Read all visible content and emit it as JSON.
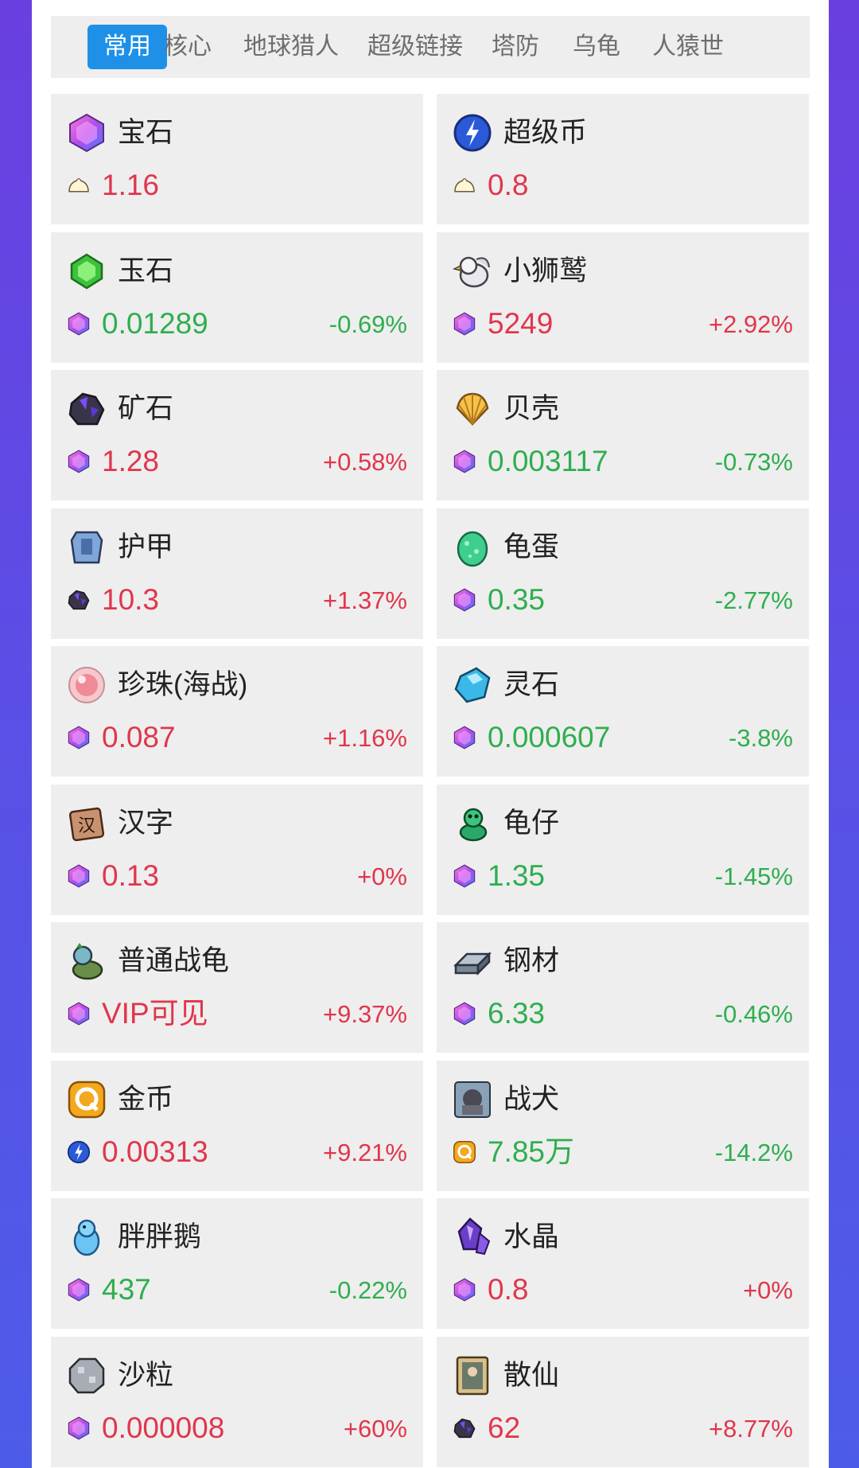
{
  "tabs": [
    {
      "label": "常用",
      "active": true
    },
    {
      "label": "核心",
      "active": false
    },
    {
      "label": "地球猎人",
      "active": false
    },
    {
      "label": "超级链接",
      "active": false
    },
    {
      "label": "塔防",
      "active": false
    },
    {
      "label": "乌龟",
      "active": false
    },
    {
      "label": "人猿世",
      "active": false
    }
  ],
  "colors": {
    "up": "#e0364d",
    "down": "#2fae4f",
    "tab_active": "#1e90e8"
  },
  "items": [
    {
      "name": "宝石",
      "icon": "gem-icon",
      "currency_icon": "bun-icon",
      "price": "1.16",
      "change": "",
      "trend": "up"
    },
    {
      "name": "超级币",
      "icon": "super-coin-icon",
      "currency_icon": "bun-icon",
      "price": "0.8",
      "change": "",
      "trend": "up"
    },
    {
      "name": "玉石",
      "icon": "jade-icon",
      "currency_icon": "gem-icon",
      "price": "0.01289",
      "change": "-0.69%",
      "trend": "down"
    },
    {
      "name": "小狮鹫",
      "icon": "griffin-icon",
      "currency_icon": "gem-icon",
      "price": "5249",
      "change": "+2.92%",
      "trend": "up"
    },
    {
      "name": "矿石",
      "icon": "ore-icon",
      "currency_icon": "gem-icon",
      "price": "1.28",
      "change": "+0.58%",
      "trend": "up"
    },
    {
      "name": "贝壳",
      "icon": "shell-icon",
      "currency_icon": "gem-icon",
      "price": "0.003117",
      "change": "-0.73%",
      "trend": "down"
    },
    {
      "name": "护甲",
      "icon": "armor-icon",
      "currency_icon": "ore-icon",
      "price": "10.3",
      "change": "+1.37%",
      "trend": "up"
    },
    {
      "name": "龟蛋",
      "icon": "turtle-egg-icon",
      "currency_icon": "gem-icon",
      "price": "0.35",
      "change": "-2.77%",
      "trend": "down"
    },
    {
      "name": "珍珠(海战)",
      "icon": "pearl-icon",
      "currency_icon": "gem-icon",
      "price": "0.087",
      "change": "+1.16%",
      "trend": "up"
    },
    {
      "name": "灵石",
      "icon": "spirit-stone-icon",
      "currency_icon": "gem-icon",
      "price": "0.000607",
      "change": "-3.8%",
      "trend": "down"
    },
    {
      "name": "汉字",
      "icon": "hanzi-tile-icon",
      "currency_icon": "gem-icon",
      "price": "0.13",
      "change": "+0%",
      "trend": "up"
    },
    {
      "name": "龟仔",
      "icon": "baby-turtle-icon",
      "currency_icon": "gem-icon",
      "price": "1.35",
      "change": "-1.45%",
      "trend": "down"
    },
    {
      "name": "普通战龟",
      "icon": "war-turtle-icon",
      "currency_icon": "gem-icon",
      "price": "VIP可见",
      "change": "+9.37%",
      "trend": "up"
    },
    {
      "name": "钢材",
      "icon": "steel-icon",
      "currency_icon": "gem-icon",
      "price": "6.33",
      "change": "-0.46%",
      "trend": "down"
    },
    {
      "name": "金币",
      "icon": "gold-coin-icon",
      "currency_icon": "super-coin-icon",
      "price": "0.00313",
      "change": "+9.21%",
      "trend": "up"
    },
    {
      "name": "战犬",
      "icon": "war-dog-icon",
      "currency_icon": "gold-coin-icon",
      "price": "7.85万",
      "change": "-14.2%",
      "trend": "down"
    },
    {
      "name": "胖胖鹅",
      "icon": "chubby-goose-icon",
      "currency_icon": "gem-icon",
      "price": "437",
      "change": "-0.22%",
      "trend": "down"
    },
    {
      "name": "水晶",
      "icon": "crystal-icon",
      "currency_icon": "gem-icon",
      "price": "0.8",
      "change": "+0%",
      "trend": "up"
    },
    {
      "name": "沙粒",
      "icon": "sand-icon",
      "currency_icon": "gem-icon",
      "price": "0.000008",
      "change": "+60%",
      "trend": "up"
    },
    {
      "name": "散仙",
      "icon": "immortal-card-icon",
      "currency_icon": "ore-icon",
      "price": "62",
      "change": "+8.77%",
      "trend": "up"
    }
  ]
}
